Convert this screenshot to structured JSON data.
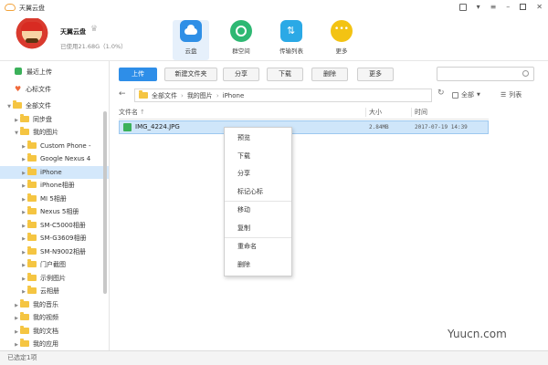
{
  "app": {
    "title": "天翼云盘"
  },
  "window_controls": [
    "feedback",
    "minimize-to-tray",
    "menu",
    "minimize",
    "maximize",
    "close"
  ],
  "user": {
    "name": "天翼云盘",
    "usage": "已使用21.68G（1.0%）"
  },
  "nav": [
    {
      "label": "云盘",
      "icon": "cloud-icon",
      "color": "#2f8fe6"
    },
    {
      "label": "群空间",
      "icon": "group-icon",
      "color": "#2eb873"
    },
    {
      "label": "传输列表",
      "icon": "transfer-icon",
      "color": "#2ba9e6"
    },
    {
      "label": "更多",
      "icon": "more-icon",
      "color": "#f3c313"
    }
  ],
  "sidebar": {
    "quick": [
      {
        "label": "最近上传",
        "icon": "recent-upload-icon",
        "color": "#3bb15a"
      },
      {
        "label": "心标文件",
        "icon": "heart-icon",
        "color": "#f0693a"
      }
    ],
    "root": "全部文件",
    "folders": [
      {
        "label": "同步盘",
        "level": 1,
        "expanded": false
      },
      {
        "label": "我的图片",
        "level": 1,
        "expanded": true
      },
      {
        "label": "Custom Phone -",
        "level": 2,
        "expanded": false
      },
      {
        "label": "Google Nexus 4",
        "level": 2,
        "expanded": false
      },
      {
        "label": "iPhone",
        "level": 2,
        "expanded": false,
        "selected": true
      },
      {
        "label": "iPhone相册",
        "level": 2,
        "expanded": false
      },
      {
        "label": "MI 5相册",
        "level": 2,
        "expanded": false
      },
      {
        "label": "Nexus 5相册",
        "level": 2,
        "expanded": false
      },
      {
        "label": "SM-C5000相册",
        "level": 2,
        "expanded": false
      },
      {
        "label": "SM-G3609相册",
        "level": 2,
        "expanded": false
      },
      {
        "label": "SM-N9002相册",
        "level": 2,
        "expanded": false
      },
      {
        "label": "门户截图",
        "level": 2,
        "expanded": false
      },
      {
        "label": "示例图片",
        "level": 2,
        "expanded": false
      },
      {
        "label": "云相册",
        "level": 2,
        "expanded": false
      },
      {
        "label": "我的音乐",
        "level": 1,
        "expanded": false
      },
      {
        "label": "我的视频",
        "level": 1,
        "expanded": false
      },
      {
        "label": "我的文档",
        "level": 1,
        "expanded": false
      },
      {
        "label": "我的应用",
        "level": 1,
        "expanded": false
      }
    ]
  },
  "toolbar": {
    "upload": "上传",
    "new_folder": "新建文件夹",
    "share": "分享",
    "download": "下载",
    "delete": "删除",
    "more": "更多"
  },
  "path": {
    "back": "←",
    "crumbs": [
      "全部文件",
      "我的图片",
      "iPhone"
    ],
    "filter": "全部",
    "view": "列表"
  },
  "table": {
    "columns": [
      "文件名",
      "大小",
      "时间"
    ],
    "rows": [
      {
        "name": "IMG_4224.JPG",
        "size": "2.84MB",
        "time": "2017-07-19 14:39"
      }
    ]
  },
  "context_menu": {
    "groups": [
      [
        "预览",
        "下载",
        "分享",
        "标记心标"
      ],
      [
        "移动",
        "复制"
      ],
      [
        "重命名",
        "删除"
      ]
    ]
  },
  "status": {
    "text": "已选定1项"
  },
  "watermark": "Yuucn.com"
}
